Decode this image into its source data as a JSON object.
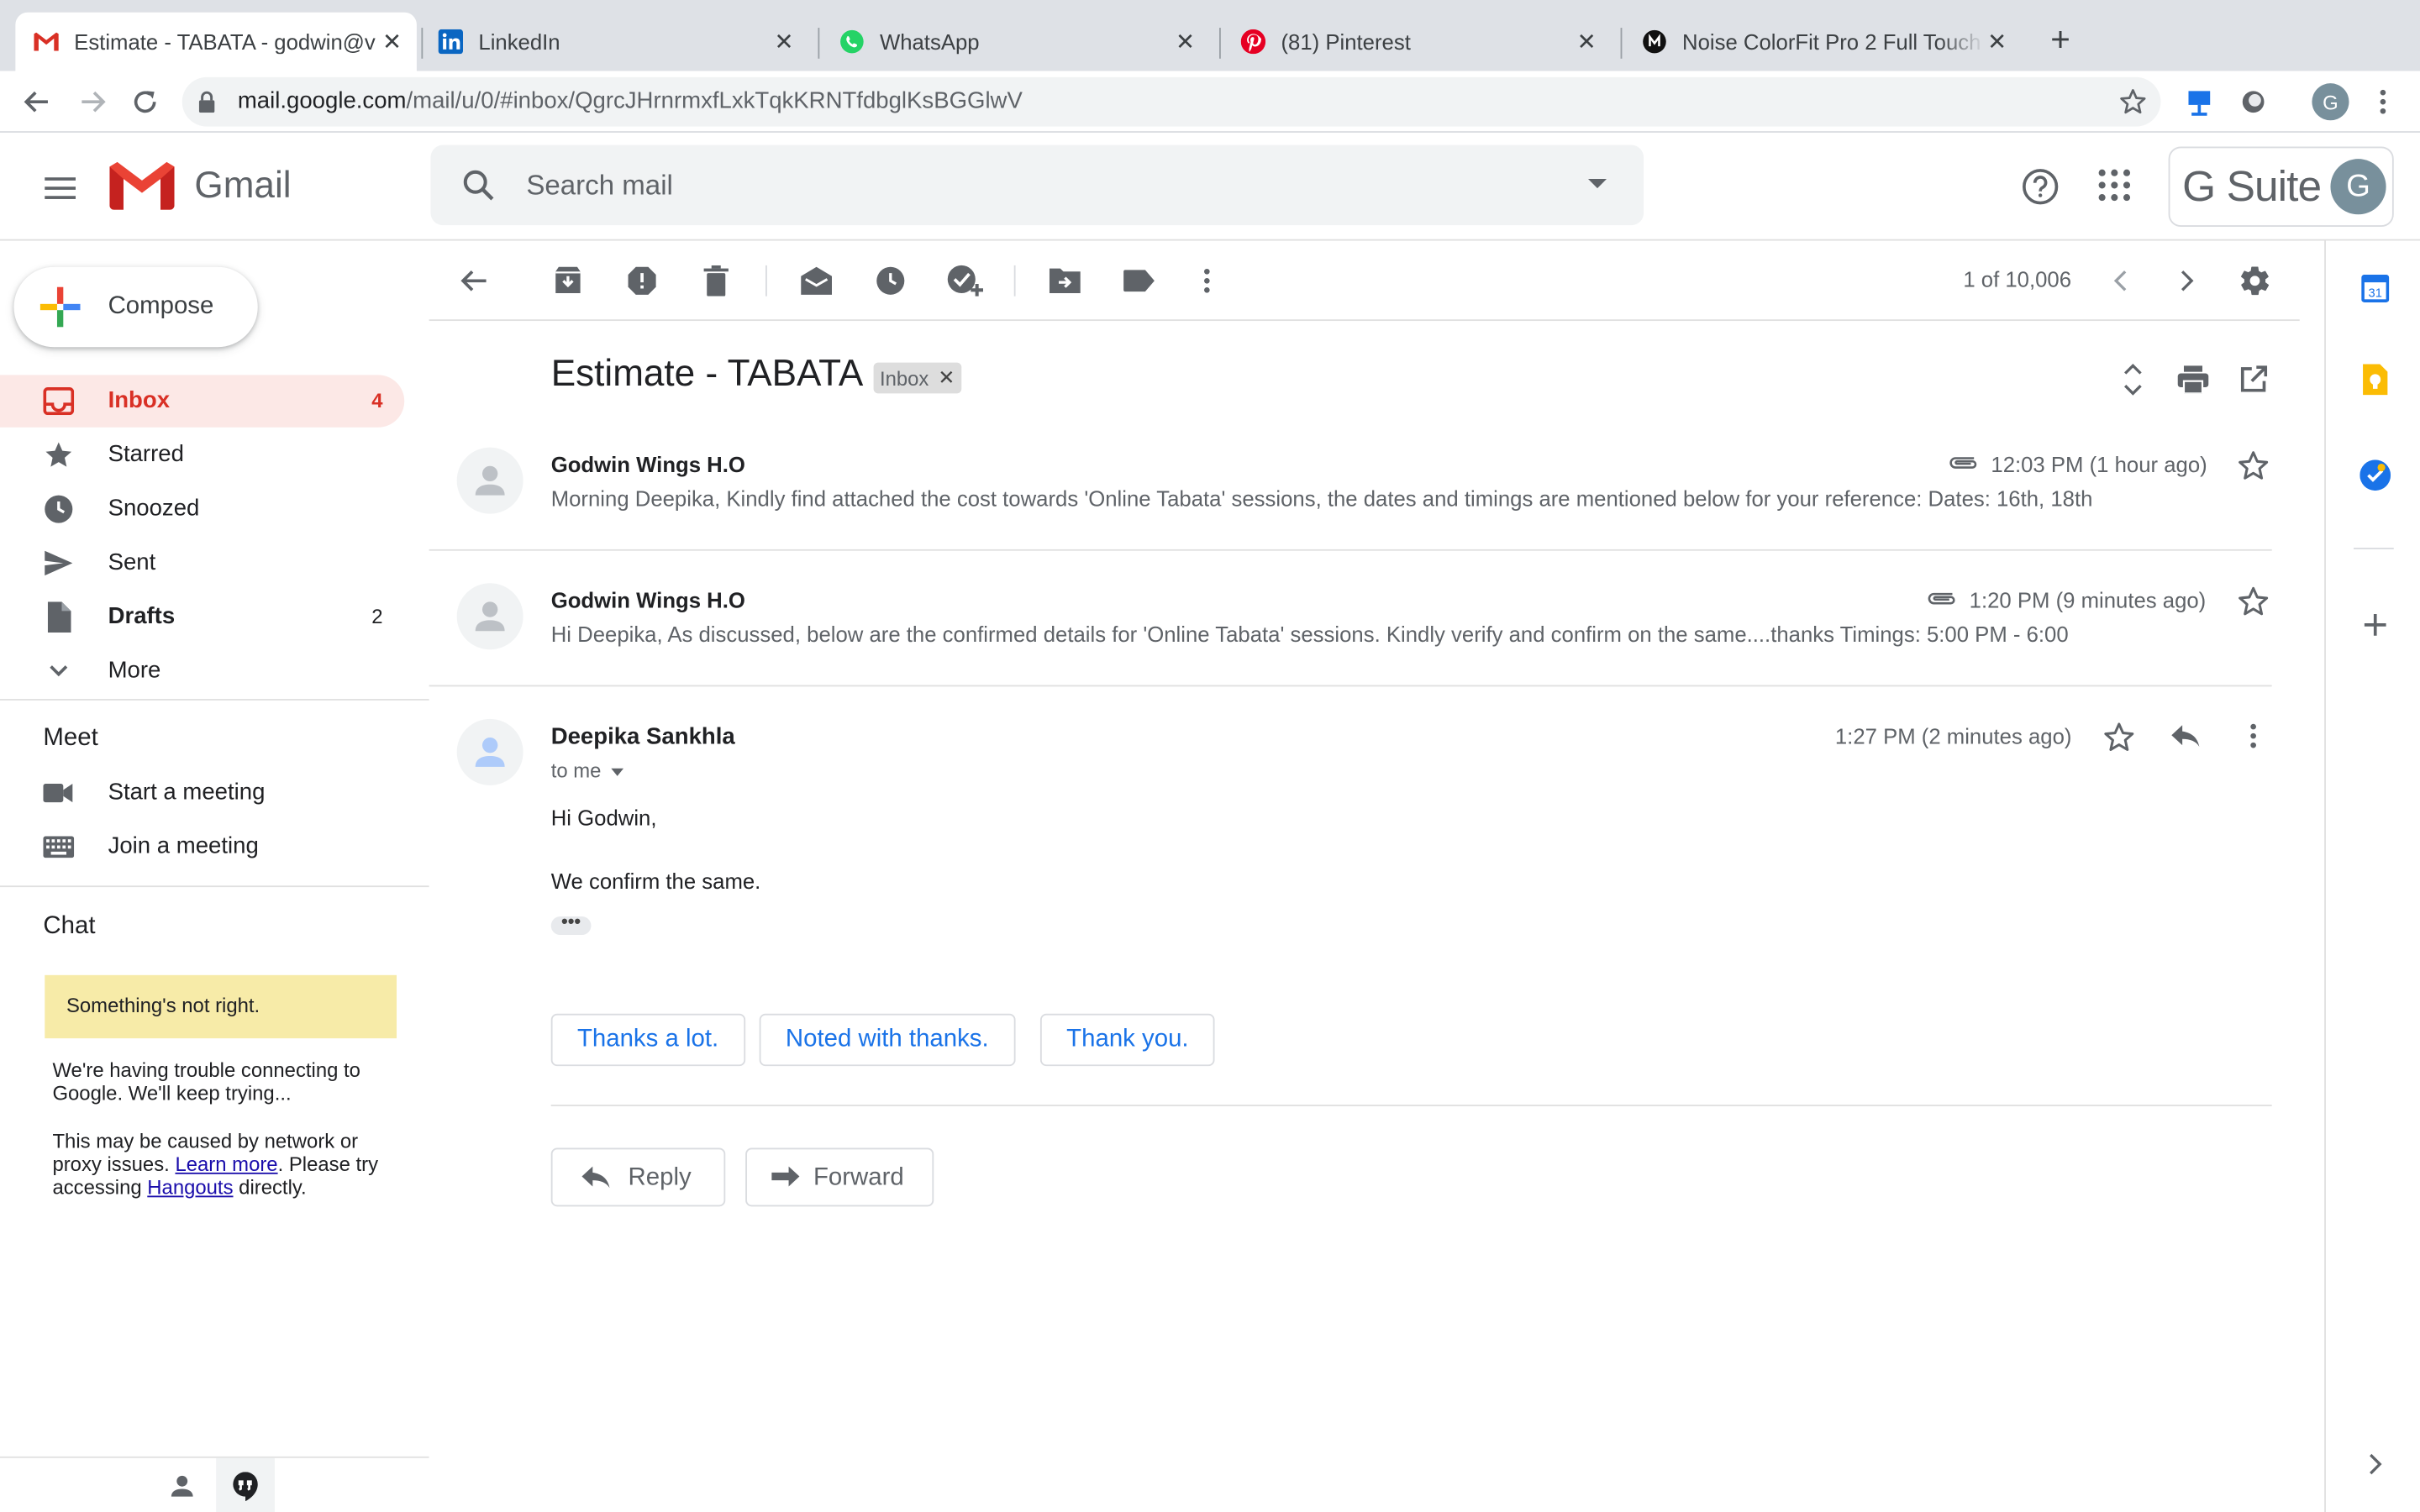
{
  "browser": {
    "tabs": [
      {
        "title": "Estimate - TABATA - godwin@v",
        "icon": "gmail-icon",
        "active": true
      },
      {
        "title": "LinkedIn",
        "icon": "linkedin-icon",
        "active": false
      },
      {
        "title": "WhatsApp",
        "icon": "whatsapp-icon",
        "active": false
      },
      {
        "title": "(81) Pinterest",
        "icon": "pinterest-icon",
        "active": false
      },
      {
        "title": "Noise ColorFit Pro 2 Full Touch",
        "icon": "noise-icon",
        "active": false
      }
    ],
    "url_host": "mail.google.com",
    "url_path": "/mail/u/0/#inbox/QgrcJHrnrmxfLxkTqkKRNTfdbglKsBGGlwV",
    "profile_initial": "G"
  },
  "gmail": {
    "app_name": "Gmail",
    "search_placeholder": "Search mail",
    "gsuite_label": "Suite",
    "gsuite_g": "G",
    "account_initial": "G"
  },
  "sidebar": {
    "compose_label": "Compose",
    "items": [
      {
        "label": "Inbox",
        "count": "4",
        "icon": "inbox-icon"
      },
      {
        "label": "Starred",
        "count": "",
        "icon": "star-icon"
      },
      {
        "label": "Snoozed",
        "count": "",
        "icon": "clock-icon"
      },
      {
        "label": "Sent",
        "count": "",
        "icon": "send-icon"
      },
      {
        "label": "Drafts",
        "count": "2",
        "icon": "draft-icon"
      },
      {
        "label": "More",
        "count": "",
        "icon": "chevron-down-icon"
      }
    ],
    "meet": {
      "title": "Meet",
      "start": "Start a meeting",
      "join": "Join a meeting"
    },
    "chat": {
      "title": "Chat",
      "warning": "Something's not right.",
      "p1": "We're having trouble connecting to Google. We'll keep trying...",
      "p2_a": "This may be caused by network or proxy issues.",
      "p2_link1": "Learn more",
      "p2_b": ". Please try accessing",
      "p2_link2": "Hangouts",
      "p2_c": "directly."
    }
  },
  "toolbar": {
    "pager": "1 of 10,006"
  },
  "thread": {
    "subject": "Estimate - TABATA",
    "label": "Inbox",
    "messages": [
      {
        "sender": "Godwin Wings H.O",
        "time": "12:03 PM (1 hour ago)",
        "snippet": "Morning Deepika, Kindly find attached the cost towards 'Online Tabata' sessions, the dates and timings are mentioned below for your reference: Dates: 16th, 18th",
        "has_attachment": true
      },
      {
        "sender": "Godwin Wings H.O",
        "time": "1:20 PM (9 minutes ago)",
        "snippet": "Hi Deepika, As discussed, below are the confirmed details for 'Online Tabata' sessions. Kindly verify and confirm on the same....thanks Timings: 5:00 PM - 6:00",
        "has_attachment": true
      },
      {
        "sender": "Deepika Sankhla",
        "time": "1:27 PM (2 minutes ago)",
        "recipient": "to me",
        "body": [
          "Hi Godwin,",
          "We confirm the same."
        ],
        "ellipsis": "•••"
      }
    ],
    "smart_replies": [
      "Thanks a lot.",
      "Noted with thanks.",
      "Thank you."
    ],
    "reply_label": "Reply",
    "forward_label": "Forward"
  },
  "colors": {
    "gmail_red": "#d93025",
    "link_blue": "#1a73e8",
    "warning_yellow": "#f7eba8"
  }
}
